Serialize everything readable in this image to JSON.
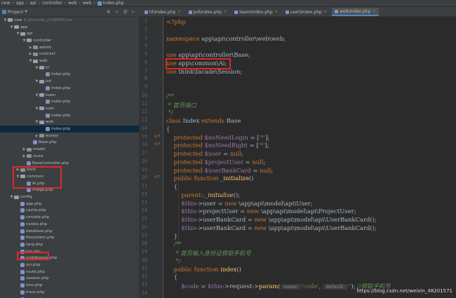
{
  "breadcrumb": [
    "new",
    "app",
    "api",
    "controller",
    "web",
    "web",
    "Index.php"
  ],
  "project_panel": {
    "label": "Project",
    "toolbar_icons": [
      "⊕",
      "÷",
      "⚙",
      "⊢"
    ]
  },
  "tabs": [
    {
      "label": "hl\\Index.php",
      "active": false
    },
    {
      "label": "jsd\\Index.php",
      "active": false
    },
    {
      "label": "team\\Index.php",
      "active": false
    },
    {
      "label": "user\\Index.php",
      "active": false
    },
    {
      "label": "web\\Index.php",
      "active": true
    }
  ],
  "tree": [
    {
      "label": "new",
      "sub": "E:\\phpstudy_pro\\WWW\\new",
      "depth": 0,
      "type": "folder",
      "open": true
    },
    {
      "label": "app",
      "depth": 1,
      "type": "folder",
      "open": true
    },
    {
      "label": "api",
      "depth": 2,
      "type": "folder",
      "open": true
    },
    {
      "label": "controller",
      "depth": 3,
      "type": "folder",
      "open": true
    },
    {
      "label": "admin",
      "depth": 4,
      "type": "folder",
      "open": false
    },
    {
      "label": "contract",
      "depth": 4,
      "type": "folder",
      "open": false
    },
    {
      "label": "web",
      "depth": 4,
      "type": "folder",
      "open": true
    },
    {
      "label": "hl",
      "depth": 5,
      "type": "folder",
      "open": true
    },
    {
      "label": "Index.php",
      "depth": 6,
      "type": "php"
    },
    {
      "label": "jsd",
      "depth": 5,
      "type": "folder",
      "open": true
    },
    {
      "label": "Index.php",
      "depth": 6,
      "type": "php"
    },
    {
      "label": "team",
      "depth": 5,
      "type": "folder",
      "open": true
    },
    {
      "label": "Index.php",
      "depth": 6,
      "type": "php"
    },
    {
      "label": "user",
      "depth": 5,
      "type": "folder",
      "open": true
    },
    {
      "label": "Index.php",
      "depth": 6,
      "type": "php"
    },
    {
      "label": "web",
      "depth": 5,
      "type": "folder",
      "open": true
    },
    {
      "label": "Index.php",
      "depth": 6,
      "type": "php",
      "selected": true
    },
    {
      "label": "worker",
      "depth": 5,
      "type": "folder",
      "open": false
    },
    {
      "label": "Base.php",
      "depth": 4,
      "type": "php"
    },
    {
      "label": "model",
      "depth": 3,
      "type": "folder",
      "open": false
    },
    {
      "label": "route",
      "depth": 3,
      "type": "folder",
      "open": false
    },
    {
      "label": "BaseController.php",
      "depth": 3,
      "type": "php"
    },
    {
      "label": "back",
      "depth": 2,
      "type": "folder",
      "open": false
    },
    {
      "label": "common",
      "depth": 2,
      "type": "folder",
      "open": true
    },
    {
      "label": "Ai.php",
      "depth": 3,
      "type": "php"
    },
    {
      "label": "Image.php",
      "depth": 3,
      "type": "php"
    },
    {
      "label": "config",
      "depth": 1,
      "type": "folder",
      "open": true
    },
    {
      "label": "app.php",
      "depth": 2,
      "type": "php"
    },
    {
      "label": "cache.php",
      "depth": 2,
      "type": "php"
    },
    {
      "label": "console.php",
      "depth": 2,
      "type": "php"
    },
    {
      "label": "cookie.php",
      "depth": 2,
      "type": "php"
    },
    {
      "label": "database.php",
      "depth": 2,
      "type": "php"
    },
    {
      "label": "filesystem.php",
      "depth": 2,
      "type": "php"
    },
    {
      "label": "lang.php",
      "depth": 2,
      "type": "php"
    },
    {
      "label": "log.php",
      "depth": 2,
      "type": "php"
    },
    {
      "label": "middleware.php",
      "depth": 2,
      "type": "php"
    },
    {
      "label": "ocr.php",
      "depth": 2,
      "type": "php"
    },
    {
      "label": "route.php",
      "depth": 2,
      "type": "php"
    },
    {
      "label": "session.php",
      "depth": 2,
      "type": "php"
    },
    {
      "label": "sms.php",
      "depth": 2,
      "type": "php"
    },
    {
      "label": "trace.php",
      "depth": 2,
      "type": "php"
    },
    {
      "label": "usms.php",
      "depth": 2,
      "type": "php"
    },
    {
      "label": "view.php",
      "depth": 2,
      "type": "php"
    }
  ],
  "gutter_lines": [
    "1",
    "2",
    "3",
    "4",
    "5",
    "6",
    "7",
    "8",
    "9",
    "10",
    "11",
    "12",
    "13",
    "14",
    "15",
    "16",
    "17",
    "18",
    "19",
    "20",
    "21",
    "22",
    "23",
    "24",
    "25",
    "26",
    "27",
    "28",
    "29",
    "30",
    "31",
    "32",
    "33",
    "34"
  ],
  "gutter_marks": [
    {
      "line": 15,
      "mark": "o↑"
    },
    {
      "line": 16,
      "mark": "o↑"
    },
    {
      "line": 20,
      "mark": "o↑"
    }
  ],
  "code": [
    [
      {
        "t": "<?php",
        "c": "kw"
      }
    ],
    [],
    [
      {
        "t": "namespace ",
        "c": "kw"
      },
      {
        "t": "app\\api\\controller\\web\\web;"
      }
    ],
    [],
    [
      {
        "t": "use ",
        "c": "kw"
      },
      {
        "t": "app\\api\\controller\\Base;"
      }
    ],
    [
      {
        "t": "use ",
        "c": "kw"
      },
      {
        "t": "app\\common\\Ai;"
      }
    ],
    [
      {
        "t": "use ",
        "c": "kw"
      },
      {
        "t": "think\\facade\\Session;"
      }
    ],
    [],
    [],
    [
      {
        "t": "/**",
        "c": "cmt"
      }
    ],
    [
      {
        "t": " * 首页接口",
        "c": "cmt"
      }
    ],
    [
      {
        "t": " */",
        "c": "cmt"
      }
    ],
    [
      {
        "t": "class ",
        "c": "kw"
      },
      {
        "t": "Index "
      },
      {
        "t": "extends ",
        "c": "kw"
      },
      {
        "t": "Base"
      }
    ],
    [
      {
        "t": "{"
      }
    ],
    [
      {
        "t": "    protected ",
        "c": "kw"
      },
      {
        "t": "$noNeedLogin",
        "c": "var"
      },
      {
        "t": " = ["
      },
      {
        "t": "'*'",
        "c": "str"
      },
      {
        "t": "];"
      }
    ],
    [
      {
        "t": "    protected ",
        "c": "kw"
      },
      {
        "t": "$noNeedRight",
        "c": "var"
      },
      {
        "t": " = ["
      },
      {
        "t": "'*'",
        "c": "str"
      },
      {
        "t": "];"
      }
    ],
    [
      {
        "t": "    protected ",
        "c": "kw"
      },
      {
        "t": "$user",
        "c": "var"
      },
      {
        "t": " = "
      },
      {
        "t": "null",
        "c": "kw"
      },
      {
        "t": ";"
      }
    ],
    [
      {
        "t": "    protected ",
        "c": "kw"
      },
      {
        "t": "$projectUser",
        "c": "var"
      },
      {
        "t": " = "
      },
      {
        "t": "null",
        "c": "kw"
      },
      {
        "t": ";"
      }
    ],
    [
      {
        "t": "    protected ",
        "c": "kw"
      },
      {
        "t": "$userBankCard",
        "c": "var"
      },
      {
        "t": " = "
      },
      {
        "t": "null",
        "c": "kw"
      },
      {
        "t": ";"
      }
    ],
    [
      {
        "t": "    public function ",
        "c": "kw"
      },
      {
        "t": "_initialize",
        "c": "fn"
      },
      {
        "t": "()"
      }
    ],
    [
      {
        "t": "    {"
      }
    ],
    [
      {
        "t": "        parent::",
        "c": "kw"
      },
      {
        "t": "_initialize",
        "c": "static"
      },
      {
        "t": "();"
      }
    ],
    [
      {
        "t": "        $this",
        "c": "var"
      },
      {
        "t": "->user = "
      },
      {
        "t": "new ",
        "c": "kw"
      },
      {
        "t": "\\app\\api\\model\\api\\User;"
      }
    ],
    [
      {
        "t": "        $this",
        "c": "var"
      },
      {
        "t": "->projectUser = "
      },
      {
        "t": "new ",
        "c": "kw"
      },
      {
        "t": "\\app\\api\\model\\api\\ProjectUser;"
      }
    ],
    [
      {
        "t": "        $this",
        "c": "var"
      },
      {
        "t": "->userBankCard = "
      },
      {
        "t": "new ",
        "c": "kw"
      },
      {
        "t": "\\app\\api\\model\\api\\UserBankCard();"
      }
    ],
    [
      {
        "t": "        $this",
        "c": "var"
      },
      {
        "t": "->userBankCard = "
      },
      {
        "t": "new ",
        "c": "kw"
      },
      {
        "t": "\\app\\api\\model\\api\\UserBankCard();"
      }
    ],
    [
      {
        "t": "    }"
      }
    ],
    [
      {
        "t": "    /**",
        "c": "cmt"
      }
    ],
    [
      {
        "t": "     * 首页输入身份证获取手机号",
        "c": "cmt"
      }
    ],
    [
      {
        "t": "     */",
        "c": "cmt"
      }
    ],
    [
      {
        "t": "    public function ",
        "c": "kw"
      },
      {
        "t": "index",
        "c": "fn"
      },
      {
        "t": "()"
      }
    ],
    [
      {
        "t": "    {"
      }
    ],
    [
      {
        "t": "        $code",
        "c": "var"
      },
      {
        "t": " = "
      },
      {
        "t": "$this",
        "c": "var"
      },
      {
        "t": "->request->"
      },
      {
        "t": "param",
        "c": "fn"
      },
      {
        "t": "("
      },
      {
        "t": " name: ",
        "c": "hint"
      },
      {
        "t": "'code'",
        "c": "str"
      },
      {
        "t": ", "
      },
      {
        "t": " default: ",
        "c": "hint"
      },
      {
        "t": "''",
        "c": "str"
      },
      {
        "t": "); "
      },
      {
        "t": "//获取手机号",
        "c": "cmt"
      }
    ],
    []
  ],
  "watermark": "https://blog.csdn.net/weixin_48201571"
}
